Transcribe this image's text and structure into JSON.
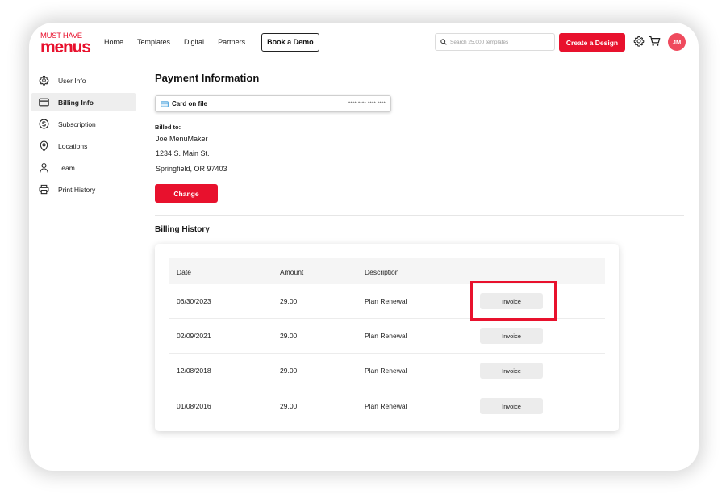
{
  "brand": {
    "logo_top": "MUST HAVE",
    "logo_bottom": "menus",
    "accent_color": "#e8112d"
  },
  "header": {
    "nav": [
      "Home",
      "Templates",
      "Digital",
      "Partners"
    ],
    "demo_label": "Book a Demo",
    "search_placeholder": "Search 25,000 templates",
    "create_label": "Create a Design",
    "avatar_initials": "JM"
  },
  "sidebar": {
    "items": [
      {
        "label": "User Info",
        "icon": "gear-icon",
        "active": false
      },
      {
        "label": "Billing Info",
        "icon": "credit-card-icon",
        "active": true
      },
      {
        "label": "Subscription",
        "icon": "dollar-circle-icon",
        "active": false
      },
      {
        "label": "Locations",
        "icon": "map-pin-icon",
        "active": false
      },
      {
        "label": "Team",
        "icon": "person-icon",
        "active": false
      },
      {
        "label": "Print History",
        "icon": "printer-icon",
        "active": false
      }
    ]
  },
  "payment": {
    "title": "Payment Information",
    "card_label": "Card on file",
    "card_mask": "**** **** **** ****",
    "billed_label": "Billed to:",
    "address": [
      "Joe MenuMaker",
      "1234 S. Main St.",
      "Springfield, OR 97403"
    ],
    "change_label": "Change"
  },
  "billing_history": {
    "title": "Billing History",
    "columns": [
      "Date",
      "Amount",
      "Description"
    ],
    "invoice_label": "Invoice",
    "rows": [
      {
        "date": "06/30/2023",
        "amount": "29.00",
        "description": "Plan Renewal"
      },
      {
        "date": "02/09/2021",
        "amount": "29.00",
        "description": "Plan Renewal"
      },
      {
        "date": "12/08/2018",
        "amount": "29.00",
        "description": "Plan Renewal"
      },
      {
        "date": "01/08/2016",
        "amount": "29.00",
        "description": "Plan Renewal"
      }
    ]
  }
}
